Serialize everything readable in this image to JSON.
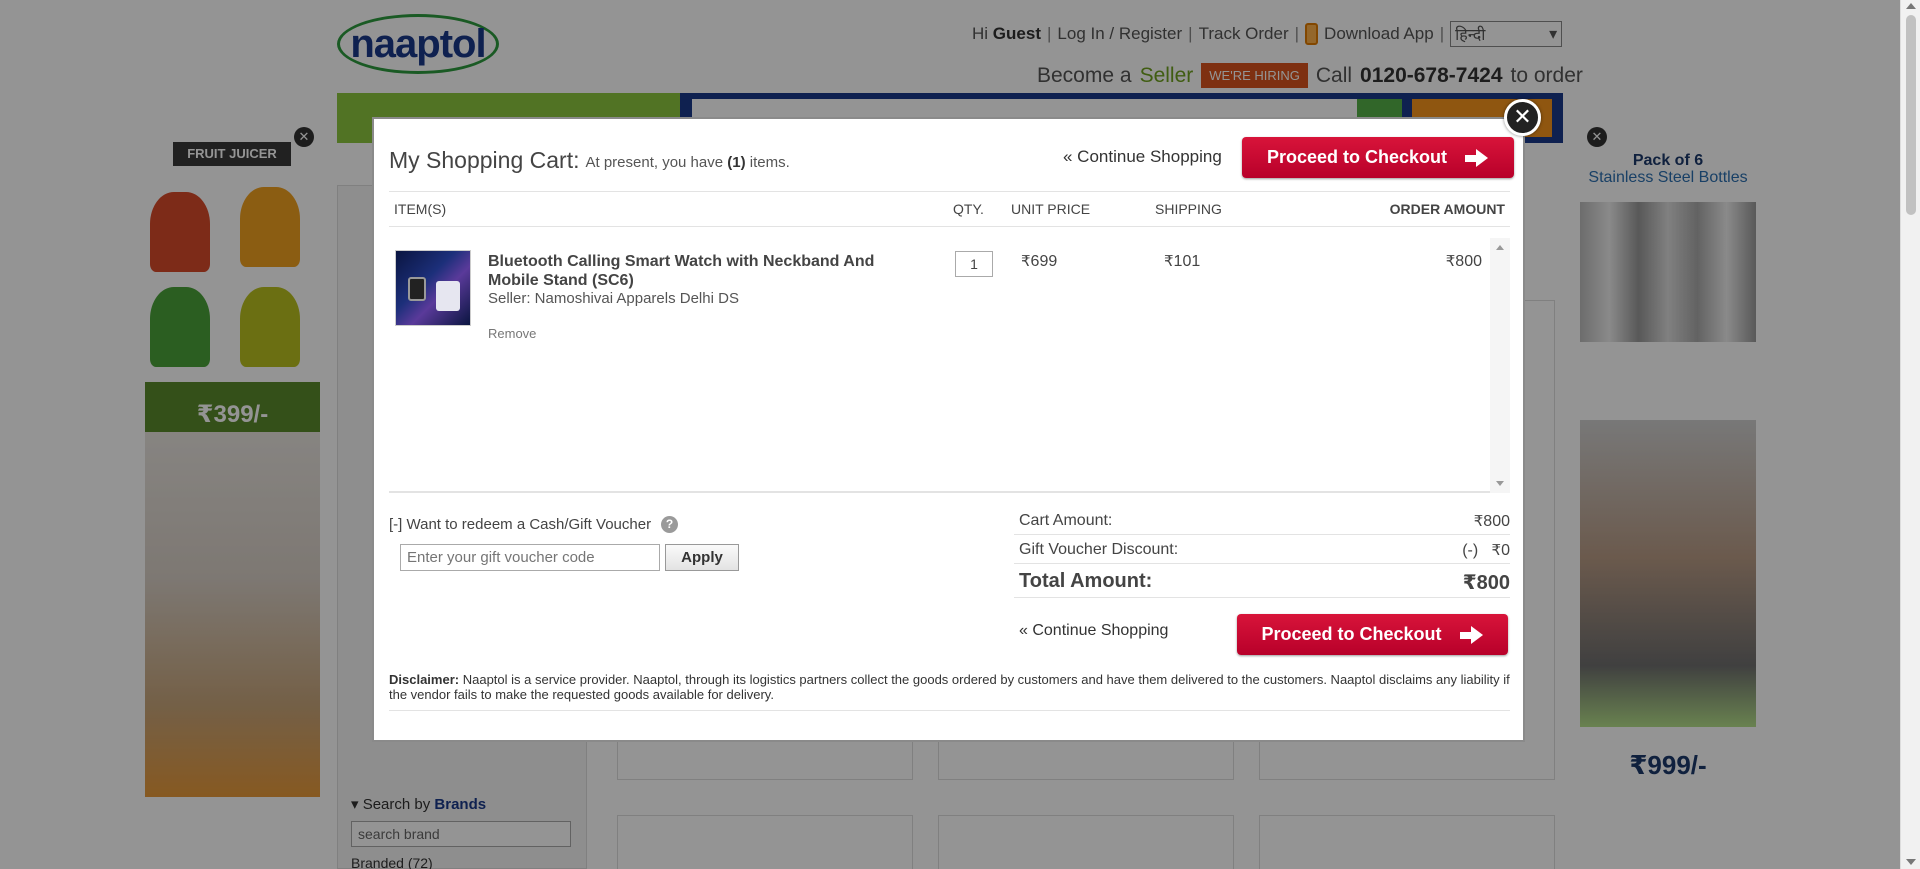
{
  "header": {
    "logo_text": "naaptol",
    "greeting_prefix": "Hi",
    "greeting_user": "Guest",
    "login_link": "Log In / Register",
    "track_order": "Track Order",
    "download_app": "Download App",
    "language": "हिन्दी",
    "become_a": "Become a",
    "seller": "Seller",
    "hiring_badge": "WE'RE HIRING",
    "call_prefix": "Call",
    "phone": "0120-678-7424",
    "call_suffix": "to order"
  },
  "sidebar": {
    "search_by": "Search by",
    "brands": "Brands",
    "brand_search_placeholder": "search brand",
    "brand_item": "Branded (72)"
  },
  "ads": {
    "left_title": "FRUIT JUICER",
    "left_price": "₹399/-",
    "right_title": "Pack of 6",
    "right_subtitle": "Stainless Steel Bottles",
    "right_price": "₹999/-"
  },
  "cart": {
    "title": "My Shopping Cart:",
    "subtitle_prefix": "At present, you have",
    "item_count": "(1)",
    "subtitle_suffix": "items.",
    "continue_shopping": "« Continue Shopping",
    "checkout_label": "Proceed to Checkout",
    "columns": {
      "items": "ITEM(S)",
      "qty": "QTY.",
      "unit_price": "UNIT PRICE",
      "shipping": "SHIPPING",
      "order_amount": "ORDER AMOUNT"
    },
    "item": {
      "name": "Bluetooth Calling Smart Watch with Neckband And Mobile Stand (SC6)",
      "seller": "Seller: Namoshivai Apparels Delhi DS",
      "remove": "Remove",
      "qty": "1",
      "unit_price": "699",
      "shipping": "101",
      "order_amount": "800"
    },
    "currency_symbol": "₹",
    "voucher": {
      "toggle_label": "[-] Want to redeem a Cash/Gift Voucher",
      "help": "?",
      "placeholder": "Enter your gift voucher code",
      "apply": "Apply"
    },
    "summary": {
      "cart_amount_label": "Cart Amount:",
      "cart_amount": "800",
      "discount_label": "Gift Voucher Discount:",
      "discount_prefix": "(-)",
      "discount": "0",
      "total_label": "Total Amount:",
      "total": "800"
    },
    "disclaimer_label": "Disclaimer:",
    "disclaimer_text": "Naaptol is a service provider. Naaptol, through its logistics partners collect the goods ordered by customers and have them delivered to the customers. Naaptol disclaims any liability if the vendor fails to make the requested goods available for delivery.",
    "close": "✕"
  },
  "colors": {
    "checkout_red": "#c8002e",
    "nav_blue": "#1a3a8a",
    "nav_green": "#8cc63f",
    "seller_green": "#6fa020",
    "hiring_orange": "#d9531e"
  }
}
